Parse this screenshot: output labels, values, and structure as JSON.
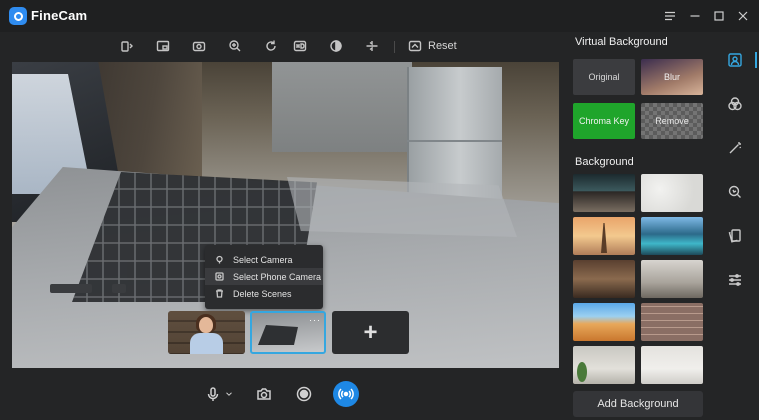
{
  "app": {
    "title": "FineCam"
  },
  "window_controls": [
    "menu-icon",
    "minimize-icon",
    "maximize-icon",
    "close-icon"
  ],
  "toolbar": {
    "icons": [
      "mirror-icon",
      "picture-in-picture-icon",
      "snapshot-icon",
      "zoom-in-icon",
      "rotate-icon",
      "hd-icon",
      "contrast-icon",
      "flip-icon"
    ],
    "reset_label": "Reset"
  },
  "context_menu": {
    "items": [
      {
        "label": "Select Camera",
        "icon": "camera-pin-icon"
      },
      {
        "label": "Select Phone Camera",
        "icon": "phone-camera-icon"
      },
      {
        "label": "Delete Scenes",
        "icon": "trash-icon"
      }
    ]
  },
  "scenes": {
    "add_label": "+",
    "more_label": "···"
  },
  "bottom_bar": {
    "icons": [
      "microphone-icon",
      "chevron-down-icon",
      "camera-icon",
      "record-icon",
      "broadcast-icon"
    ]
  },
  "virtual_background": {
    "heading": "Virtual Background",
    "options": [
      "Original",
      "Blur",
      "Chroma Key",
      "Remove"
    ]
  },
  "background": {
    "heading": "Background",
    "thumbnails": [
      "office-room",
      "white-texture",
      "eiffel-tower",
      "lake-mountains",
      "living-room",
      "bedroom",
      "desert-dunes",
      "brick-wall",
      "plant-room",
      "white-room"
    ],
    "add_label": "Add Background"
  },
  "rail": {
    "items": [
      "portrait-icon",
      "filters-icon",
      "magic-wand-icon",
      "touch-up-icon",
      "cards-icon",
      "sliders-icon"
    ],
    "active": "portrait-icon"
  },
  "colors": {
    "accent": "#35a7e0",
    "chroma": "#1fa52b",
    "live": "#1e88e5"
  }
}
